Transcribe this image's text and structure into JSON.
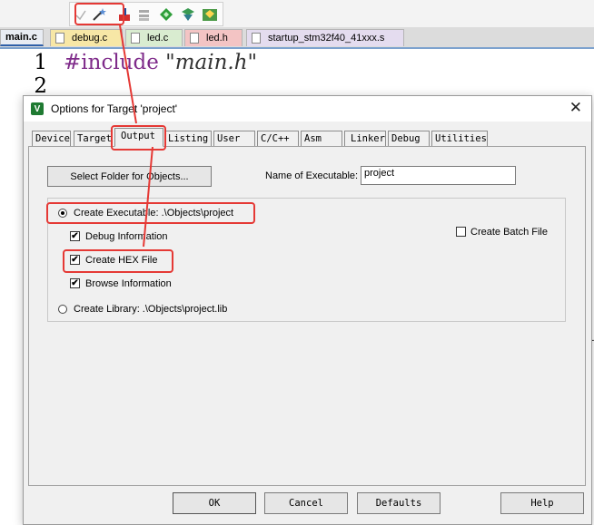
{
  "toolbar": {
    "icons": [
      "check-icon",
      "magic-wand-icon",
      "load-download-icon",
      "batch-icon",
      "diamond-icon",
      "select-device-icon",
      "pack-installer-icon"
    ]
  },
  "file_tabs": [
    {
      "label": "main.c",
      "color": "#e8ecf3",
      "active": true
    },
    {
      "label": "debug.c",
      "color": "#f7e7a6"
    },
    {
      "label": "led.c",
      "color": "#d9ecd0"
    },
    {
      "label": "led.h",
      "color": "#f3c4c4"
    },
    {
      "label": "startup_stm32f40_41xxx.s",
      "color": "#e4dcef"
    }
  ],
  "editor": {
    "line_numbers": [
      "1",
      "2"
    ],
    "code_line_1_keyword": "#include",
    "code_line_1_string": "\"main.h\""
  },
  "dialog": {
    "title": "Options for Target 'project'",
    "close_symbol": "✕",
    "tabs": [
      "Device",
      "Target",
      "Output",
      "Listing",
      "User",
      "C/C++",
      "Asm",
      "Linker",
      "Debug",
      "Utilities"
    ],
    "active_tab": "Output",
    "select_folder_button": "Select Folder for Objects...",
    "name_of_executable_label": "Name of Executable:",
    "name_of_executable_value": "project",
    "create_executable_label": "Create Executable:  .\\Objects\\project",
    "create_executable_selected": true,
    "debug_information_label": "Debug Information",
    "debug_information_checked": true,
    "create_hex_file_label": "Create HEX File",
    "create_hex_file_checked": true,
    "browse_information_label": "Browse Information",
    "browse_information_checked": true,
    "create_batch_file_label": "Create Batch File",
    "create_batch_file_checked": false,
    "create_library_label": "Create Library:  .\\Objects\\project.lib",
    "create_library_selected": false,
    "check_mark": "✔",
    "buttons": {
      "ok": "OK",
      "cancel": "Cancel",
      "defaults": "Defaults",
      "help": "Help"
    }
  },
  "annotation_color": "#e53935"
}
